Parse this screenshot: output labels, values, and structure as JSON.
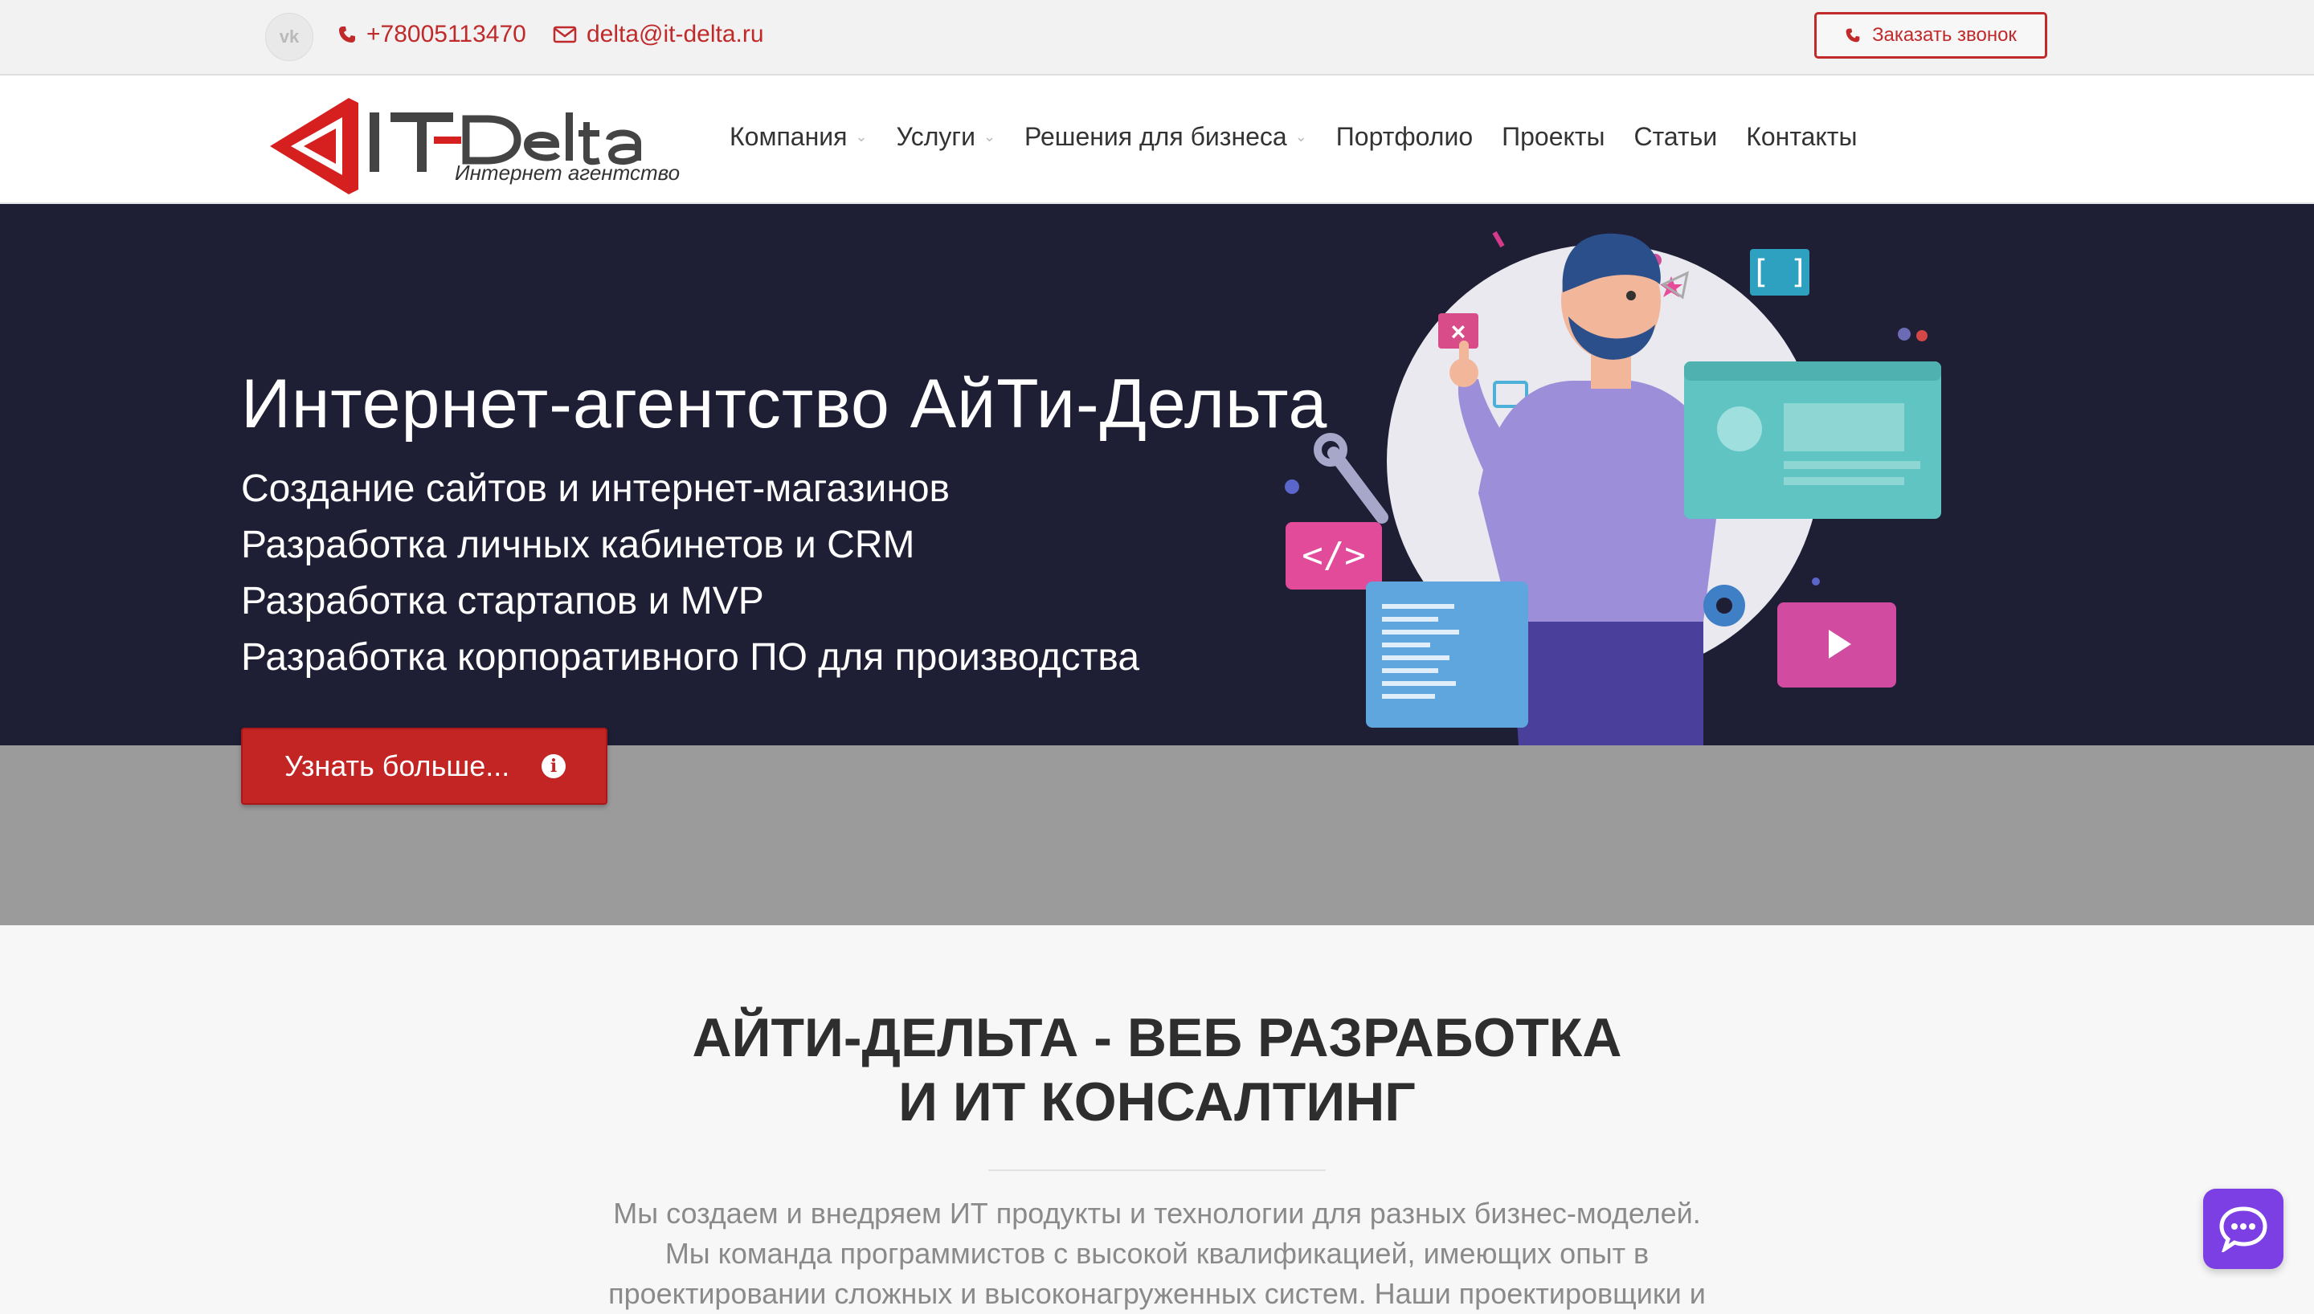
{
  "topbar": {
    "vk_label": "vk",
    "phone": "+78005113470",
    "email": "delta@it-delta.ru",
    "callback_label": "Заказать звонок"
  },
  "logo": {
    "name": "IT-Delta",
    "tagline": "Интернет агентство"
  },
  "nav": {
    "items": [
      {
        "label": "Компания",
        "has_dropdown": true
      },
      {
        "label": "Услуги",
        "has_dropdown": true
      },
      {
        "label": "Решения для бизнеса",
        "has_dropdown": true
      },
      {
        "label": "Портфолио",
        "has_dropdown": false
      },
      {
        "label": "Проекты",
        "has_dropdown": false
      },
      {
        "label": "Статьи",
        "has_dropdown": false
      },
      {
        "label": "Контакты",
        "has_dropdown": false
      }
    ]
  },
  "hero": {
    "title": "Интернет-агентство АйТи-Дельта",
    "lines": [
      "Создание сайтов и интернет-магазинов",
      "Разработка личных кабинетов и CRM",
      "Разработка стартапов и MVP",
      "Разработка корпоративного ПО для производства"
    ],
    "button_label": "Узнать больше...",
    "button_icon": "i"
  },
  "section": {
    "title_lines": [
      "АЙТИ-ДЕЛЬТА - ВЕБ РАЗРАБОТКА",
      "И ИТ КОНСАЛТИНГ"
    ],
    "text_lines": [
      "Мы создаем и внедряем ИТ продукты и технологии для разных бизнес-моделей.",
      "Мы команда программистов с высокой квалификацией, имеющих опыт в",
      "проектировании сложных и высоконагруженных систем. Наши проектировщики и"
    ]
  },
  "colors": {
    "brand_red": "#c02a2a",
    "hero_bg": "#1e1e35",
    "chat_purple": "#7b3fe4"
  }
}
